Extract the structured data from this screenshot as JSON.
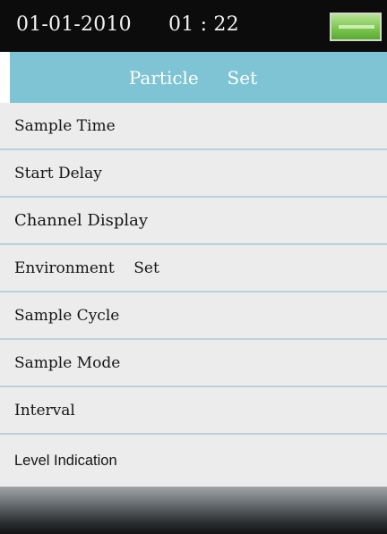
{
  "status": {
    "date": "01-01-2010",
    "time": "01 : 22",
    "battery_icon": "battery-full-icon",
    "battery_color": "#6fbe45"
  },
  "header": {
    "title": "Particle     Set",
    "background": "#7ec4d4"
  },
  "menu": {
    "items": [
      {
        "label": "Sample Time"
      },
      {
        "label": "Start Delay"
      },
      {
        "label": "Channel Display"
      },
      {
        "label": "Environment    Set"
      },
      {
        "label": "Sample Cycle"
      },
      {
        "label": "Sample Mode"
      },
      {
        "label": "Interval"
      },
      {
        "label": "Level Indication"
      }
    ]
  }
}
